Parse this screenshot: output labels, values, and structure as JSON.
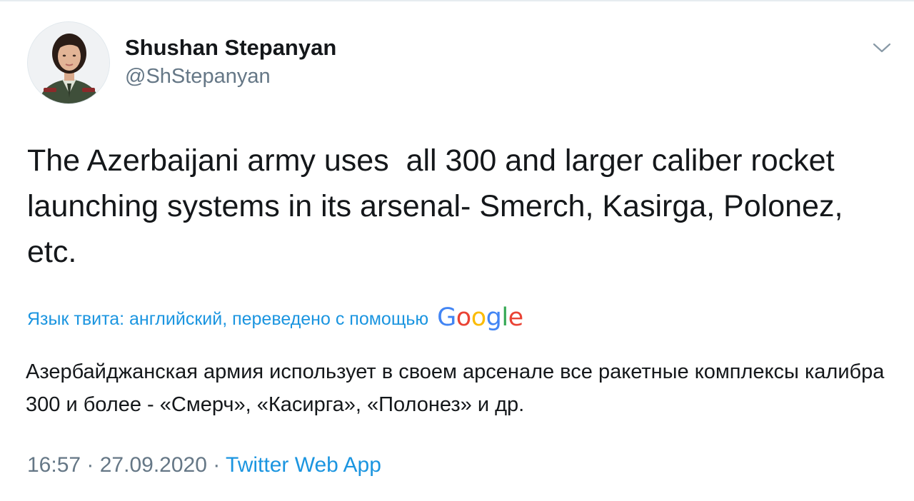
{
  "author": {
    "name": "Shushan Stepanyan",
    "handle": "@ShStepanyan",
    "avatar": "profile-photo"
  },
  "menu": {
    "icon": "chevron-down-icon"
  },
  "tweet": {
    "text": "The Azerbaijani army uses  all 300 and larger caliber rocket launching systems in its arsenal- Smerch, Kasirga, Polonez, etc."
  },
  "translation": {
    "label": "Язык твита: английский, переведено с помощью",
    "provider": {
      "letters": [
        "G",
        "o",
        "o",
        "g",
        "l",
        "e"
      ],
      "colors": [
        "#4285f4",
        "#ea4335",
        "#fbbc05",
        "#4285f4",
        "#34a853",
        "#ea4335"
      ]
    },
    "text": "Азербайджанская армия использует в своем арсенале все ракетные комплексы калибра 300 и более - «Смерч», «Касирга», «Полонез» и др."
  },
  "meta": {
    "time": "16:57",
    "separator": "·",
    "date": "27.09.2020",
    "source": "Twitter Web App"
  },
  "colors": {
    "link": "#1b95e0",
    "secondary": "#657786",
    "text": "#14171a"
  }
}
